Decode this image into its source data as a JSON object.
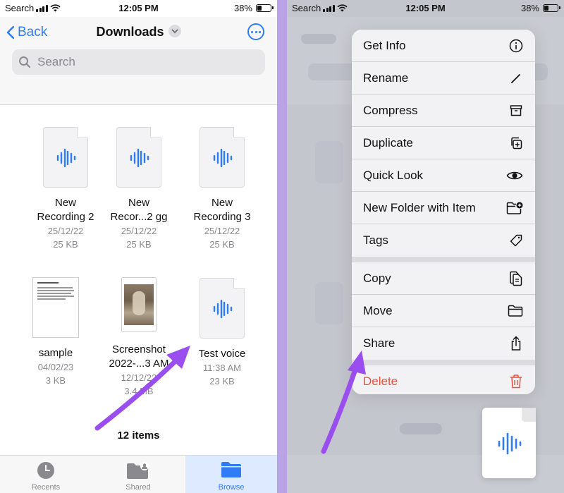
{
  "status": {
    "carrier": "Search",
    "time": "12:05 PM",
    "battery": "38%",
    "battery_level": 0.38
  },
  "nav": {
    "back_label": "Back",
    "title": "Downloads",
    "search_placeholder": "Search"
  },
  "files": [
    {
      "name1": "New",
      "name2": "Recording 2",
      "date": "25/12/22",
      "size": "25 KB",
      "kind": "audio"
    },
    {
      "name1": "New",
      "name2": "Recor...2 gg",
      "date": "25/12/22",
      "size": "25 KB",
      "kind": "audio"
    },
    {
      "name1": "New",
      "name2": "Recording 3",
      "date": "25/12/22",
      "size": "25 KB",
      "kind": "audio"
    },
    {
      "name1": "sample",
      "name2": "",
      "date": "04/02/23",
      "size": "3 KB",
      "kind": "pdf"
    },
    {
      "name1": "Screenshot",
      "name2": "2022-...3 AM",
      "date": "12/12/22",
      "size": "3.4 MB",
      "kind": "image"
    },
    {
      "name1": "Test voice",
      "name2": "",
      "date": "11:38 AM",
      "size": "23 KB",
      "kind": "audio"
    }
  ],
  "items_count": "12 items",
  "tabs": {
    "recents": "Recents",
    "shared": "Shared",
    "browse": "Browse"
  },
  "menu": {
    "get_info": "Get Info",
    "rename": "Rename",
    "compress": "Compress",
    "duplicate": "Duplicate",
    "quick_look": "Quick Look",
    "new_folder": "New Folder with Item",
    "tags": "Tags",
    "copy": "Copy",
    "move": "Move",
    "share": "Share",
    "delete": "Delete"
  },
  "colors": {
    "accent": "#2f7cf6",
    "destructive": "#e8503f",
    "annotation_arrow": "#9a4ef0",
    "audio_icon": "#2f7cf6"
  },
  "icons": {
    "get_info": "info-circle-icon",
    "rename": "pencil-icon",
    "compress": "archive-box-icon",
    "duplicate": "duplicate-plus-icon",
    "quick_look": "eye-icon",
    "new_folder": "folder-badge-plus-icon",
    "tags": "tag-icon",
    "copy": "copy-document-icon",
    "move": "folder-icon",
    "share": "share-icon",
    "delete": "trash-icon"
  }
}
